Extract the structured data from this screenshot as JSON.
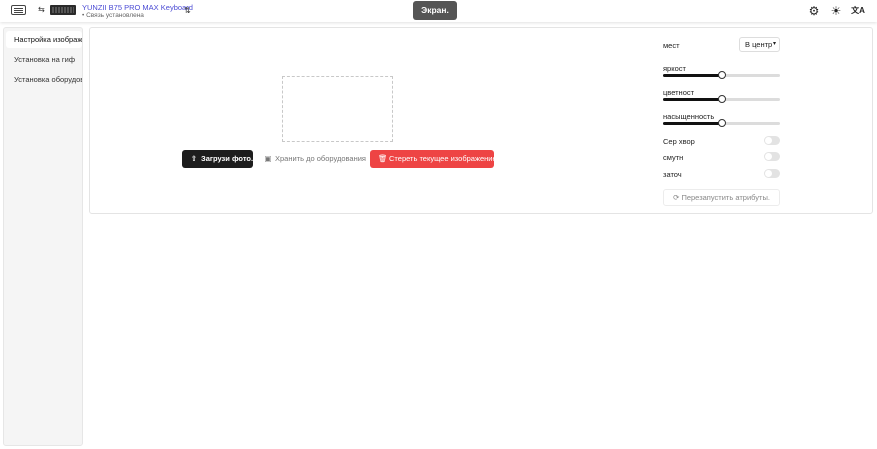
{
  "header": {
    "device_name": "YUNZII B75 PRO MAX Keyboard",
    "device_status": "Связь установлена",
    "status_dot": "•",
    "screen_button": "Экран.",
    "icons": {
      "keyboard": "keyboard-icon",
      "swap": "⇆",
      "sort": "⇅",
      "settings": "⚙",
      "theme": "☀",
      "language": "文A"
    }
  },
  "sidebar": {
    "items": [
      {
        "label": "Настройка изображения",
        "active": true
      },
      {
        "label": "Установка на гиф",
        "active": false
      },
      {
        "label": "Установка оборудования",
        "active": false
      }
    ]
  },
  "main": {
    "upload_button": "Загрузи фото.",
    "save_button": "Хранить до оборудования",
    "clear_button": "Стереть текущее изображение",
    "upload_icon": "⇧",
    "save_icon": "▣",
    "clear_icon": "🗑"
  },
  "settings": {
    "position_label": "мест",
    "position_value": "В центр",
    "brightness_label": "яркост",
    "brightness_level": 0.5,
    "color_label": "цветност",
    "color_level": 0.5,
    "saturation_label": "насыщенность",
    "saturation_level": 0.5,
    "grayscale_label": "Сер хвор",
    "grayscale_on": false,
    "blur_label": "смутн",
    "blur_on": false,
    "sharpen_label": "заточ",
    "sharpen_on": false,
    "reset_button": "Перезапустить атрибуты.",
    "reset_icon": "⟳"
  },
  "colors": {
    "accent_link": "#4b4bd4",
    "danger": "#ee4444",
    "primary_dark": "#1d1d1d"
  }
}
